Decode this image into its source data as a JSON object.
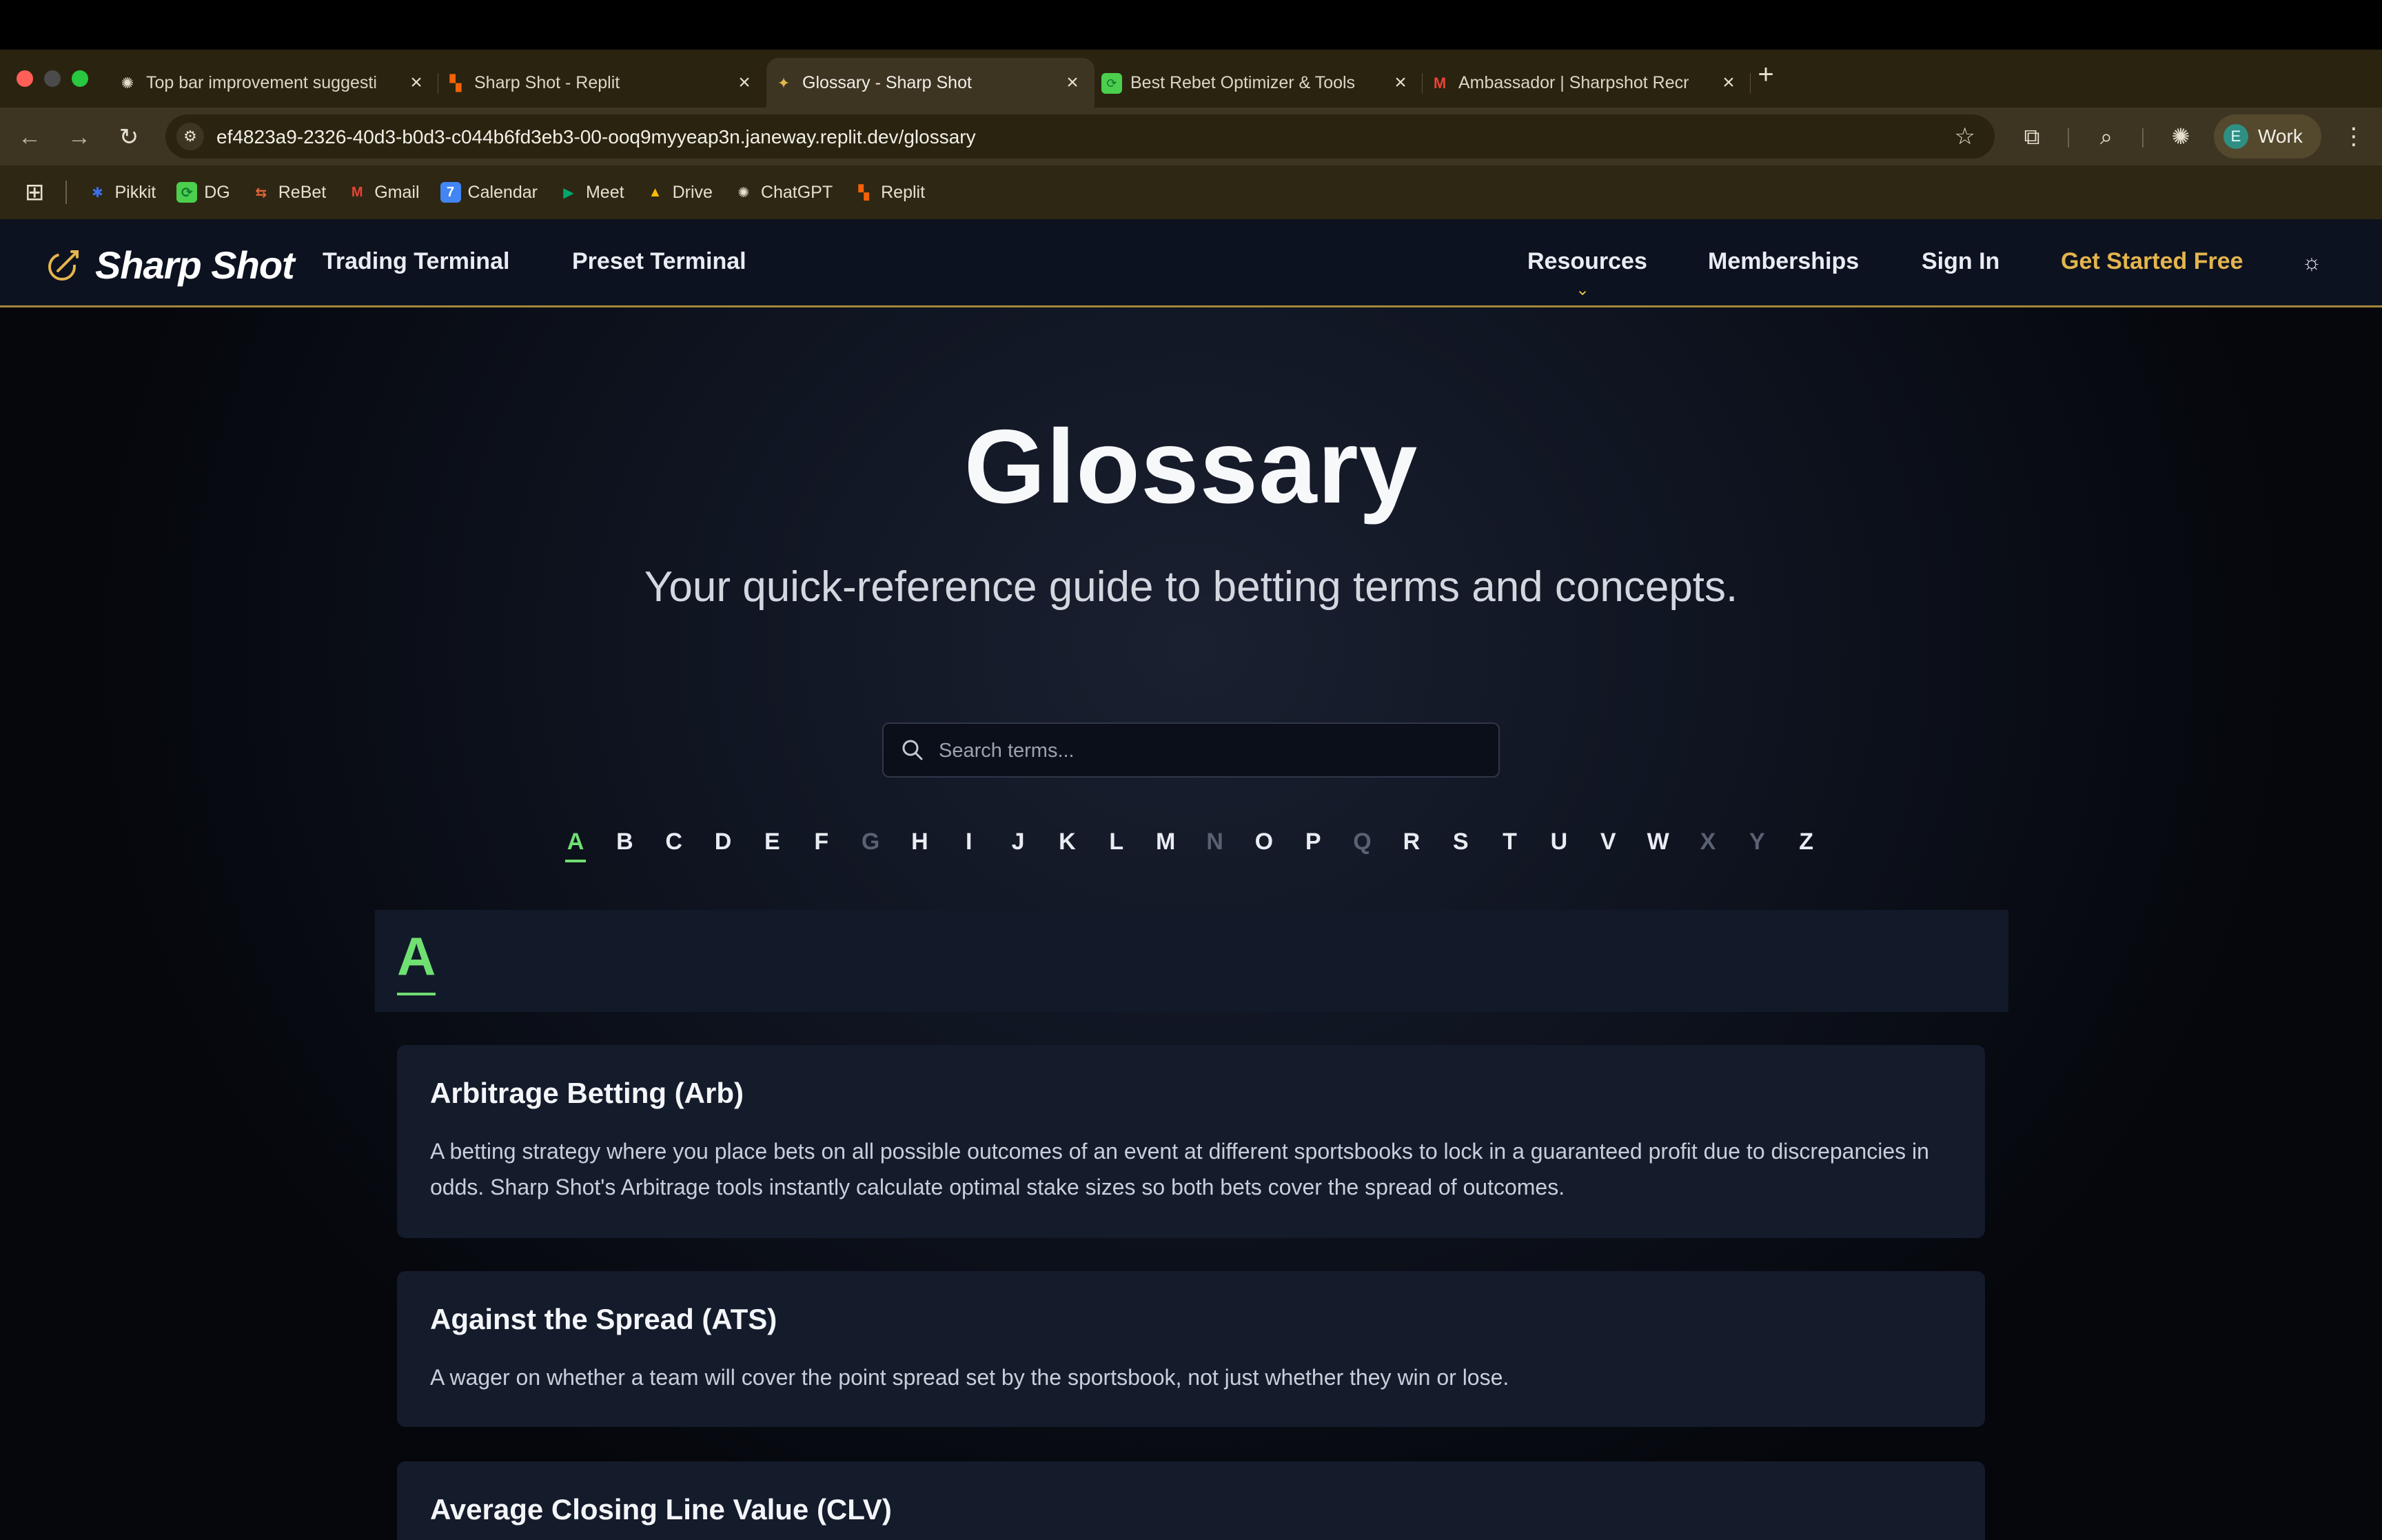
{
  "browser": {
    "tabs": [
      {
        "title": "Top bar improvement suggesti",
        "favicon": "openai-icon",
        "active": false
      },
      {
        "title": "Sharp Shot - Replit",
        "favicon": "replit-icon",
        "active": false
      },
      {
        "title": "Glossary - Sharp Shot",
        "favicon": "sharpshot-icon",
        "active": true
      },
      {
        "title": "Best Rebet Optimizer & Tools",
        "favicon": "dg-icon",
        "active": false
      },
      {
        "title": "Ambassador | Sharpshot Recr",
        "favicon": "gmail-icon",
        "active": false
      }
    ],
    "url": "ef4823a9-2326-40d3-b0d3-c044b6fd3eb3-00-ooq9myyeap3n.janeway.replit.dev/glossary",
    "profile": {
      "initial": "E",
      "label": "Work"
    },
    "bookmarks": [
      {
        "label": "Pikkit",
        "icon": "pikkit-icon",
        "color": "#3b6ff2"
      },
      {
        "label": "DG",
        "icon": "dg-icon",
        "color": "#4ccf4c"
      },
      {
        "label": "ReBet",
        "icon": "rebet-icon",
        "color": "#e2663a"
      },
      {
        "label": "Gmail",
        "icon": "gmail-icon",
        "color": "#ea4335"
      },
      {
        "label": "Calendar",
        "icon": "calendar-icon",
        "color": "#4285f4"
      },
      {
        "label": "Meet",
        "icon": "meet-icon",
        "color": "#00a86b"
      },
      {
        "label": "Drive",
        "icon": "drive-icon",
        "color": "#fbbc04"
      },
      {
        "label": "ChatGPT",
        "icon": "openai-icon",
        "color": "#e6e0d0"
      },
      {
        "label": "Replit",
        "icon": "replit-icon",
        "color": "#f26207"
      }
    ]
  },
  "site": {
    "brand": "Sharp Shot",
    "nav_left": [
      "Trading Terminal",
      "Preset Terminal"
    ],
    "nav_right": {
      "resources": "Resources",
      "memberships": "Memberships",
      "sign_in": "Sign In",
      "cta": "Get Started Free"
    },
    "accent_color": "#e3b54d",
    "green_color": "#6fe071"
  },
  "hero": {
    "title": "Glossary",
    "subtitle": "Your quick-reference guide to betting terms and concepts."
  },
  "search": {
    "placeholder": "Search terms...",
    "value": ""
  },
  "alphabet": {
    "letters": [
      "A",
      "B",
      "C",
      "D",
      "E",
      "F",
      "G",
      "H",
      "I",
      "J",
      "K",
      "L",
      "M",
      "N",
      "O",
      "P",
      "Q",
      "R",
      "S",
      "T",
      "U",
      "V",
      "W",
      "X",
      "Y",
      "Z"
    ],
    "active": "A",
    "disabled": [
      "G",
      "N",
      "Q",
      "X",
      "Y"
    ]
  },
  "section": {
    "letter": "A",
    "terms": [
      {
        "title": "Arbitrage Betting (Arb)",
        "definition": "A betting strategy where you place bets on all possible outcomes of an event at different sportsbooks to lock in a guaranteed profit due to discrepancies in odds. Sharp Shot's Arbitrage tools instantly calculate optimal stake sizes so both bets cover the spread of outcomes."
      },
      {
        "title": "Against the Spread (ATS)",
        "definition": "A wager on whether a team will cover the point spread set by the sportsbook, not just whether they win or lose."
      },
      {
        "title": "Average Closing Line Value (CLV)",
        "definition": ""
      }
    ]
  }
}
